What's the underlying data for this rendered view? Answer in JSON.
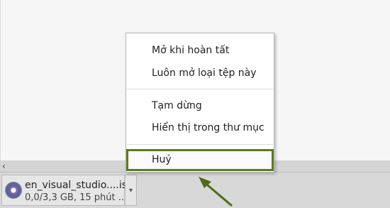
{
  "context_menu": {
    "items": [
      {
        "label": "Mở khi hoàn tất"
      },
      {
        "label": "Luôn mở loại tệp này"
      },
      {
        "label": "Tạm dừng"
      },
      {
        "label": "Hiển thị trong thư mục"
      },
      {
        "label": "Huỷ"
      }
    ]
  },
  "download": {
    "file_name": "en_visual_studio....iso",
    "status": "0,0/3,3 GB, 15 phút ..."
  },
  "colors": {
    "highlight_border": "#5e7a1e",
    "arrow": "#4f6a1a"
  },
  "icons": {
    "scroll_left": "chevron-left-icon",
    "dropdown": "chevron-down-icon",
    "file": "disc-image-icon"
  }
}
